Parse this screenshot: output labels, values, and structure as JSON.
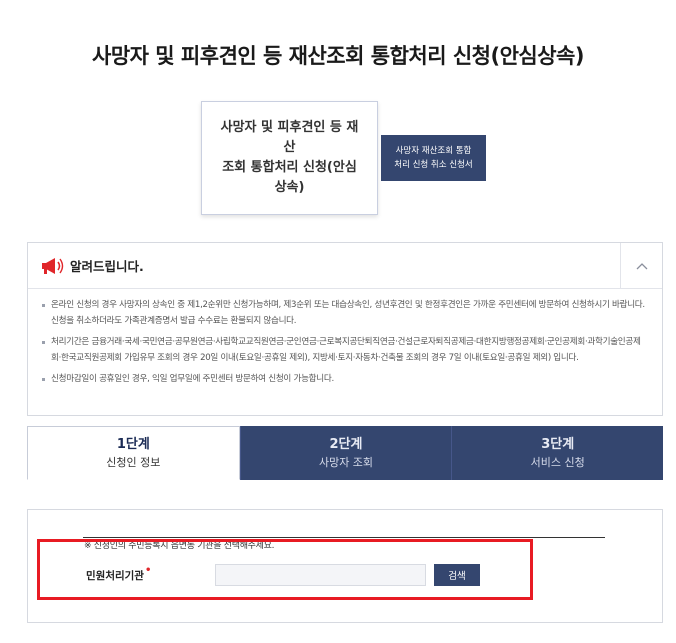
{
  "page": {
    "title": "사망자 및 피후견인 등 재산조회 통합처리 신청(안심상속)"
  },
  "service_card": {
    "label_lines": [
      "사망자 및 피후견인 등 재",
      "산",
      "조회 통합처리 신청(안심",
      "상속)"
    ]
  },
  "cancel_button": {
    "label_lines": [
      "사망자 재산조회 통합",
      "처리 신청 취소 신청서"
    ]
  },
  "notice": {
    "title": "알려드립니다.",
    "items": [
      "온라인 신청의 경우 사망자의 상속인 중 제1,2순위만 신청가능하며, 제3순위 또는 대습상속인, 성년후견인 및 한정후견인은 가까운 주민센터에 방문하여 신청하시기 바랍니다. 신청을 취소하더라도 가족관계증명서 발급 수수료는 환불되지 않습니다.",
      "처리기간은 금융거래·국세·국민연금·공무원연금·사립학교교직원연금·군인연금·근로복지공단퇴직연금·건설근로자퇴직공제금·대한지방행정공제회·군인공제회·과학기술인공제회·한국교직원공제회 가입유무 조회의 경우 20일 이내(토요일·공휴일 제외), 지방세·토지·자동차·건축물 조회의 경우 7일 이내(토요일·공휴일 제외) 입니다.",
      "신청마감일이 공휴일인 경우, 익일 업무일에 주민센터 방문하여 신청이 가능합니다."
    ]
  },
  "steps": [
    {
      "number": "1단계",
      "label": "신청인 정보",
      "active": true
    },
    {
      "number": "2단계",
      "label": "사망자 조회",
      "active": false
    },
    {
      "number": "3단계",
      "label": "서비스 신청",
      "active": false
    }
  ],
  "form": {
    "note": "※ 신청인의 주민등록지 읍면동 기관을 선택해주세요.",
    "org_label": "민원처리기관",
    "required_mark": "•",
    "org_value": "",
    "search_label": "검색"
  },
  "colors": {
    "navy": "#34466f",
    "highlight": "#e81b23",
    "required": "#e0262a"
  }
}
